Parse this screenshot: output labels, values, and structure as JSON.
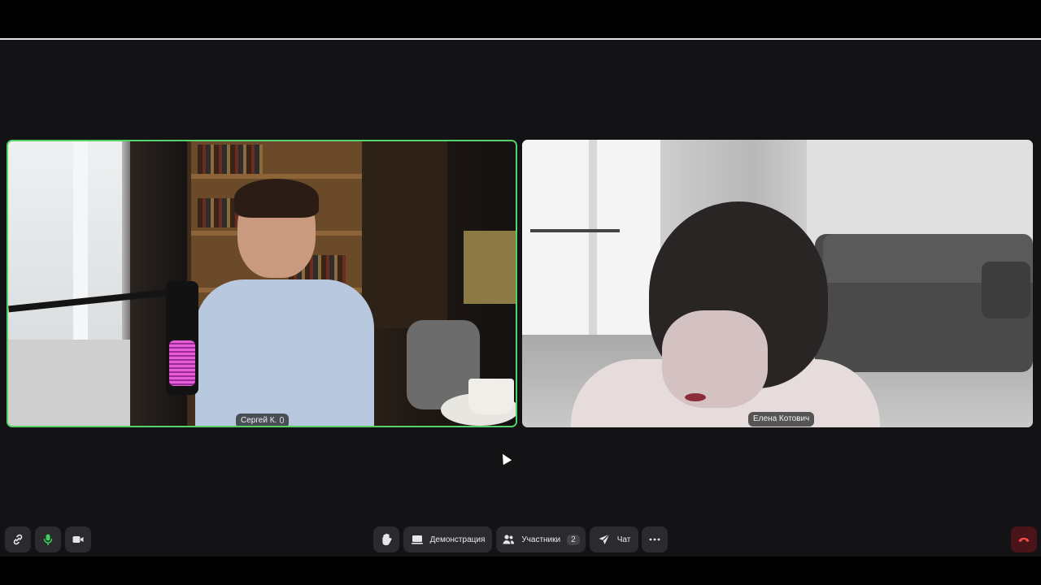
{
  "participants": [
    {
      "name": "Сергей К.",
      "active_speaker": true
    },
    {
      "name": "Елена Котович",
      "active_speaker": false
    }
  ],
  "toolbar": {
    "left": [
      {
        "icon": "link-icon"
      },
      {
        "icon": "mic-icon",
        "color": "#3bd15a"
      },
      {
        "icon": "camera-icon"
      }
    ],
    "raise_hand_icon": "hand-icon",
    "demo_label": "Демонстрация",
    "participants_label": "Участники",
    "participants_count": "2",
    "chat_label": "Чат",
    "more_icon": "more-icon",
    "end_call_icon": "phone-hangup-icon"
  },
  "colors": {
    "active_speaker_border": "#57d26a",
    "background": "#131315",
    "end_call_bg": "#4b1418",
    "end_call_icon": "#ff4b4b"
  }
}
